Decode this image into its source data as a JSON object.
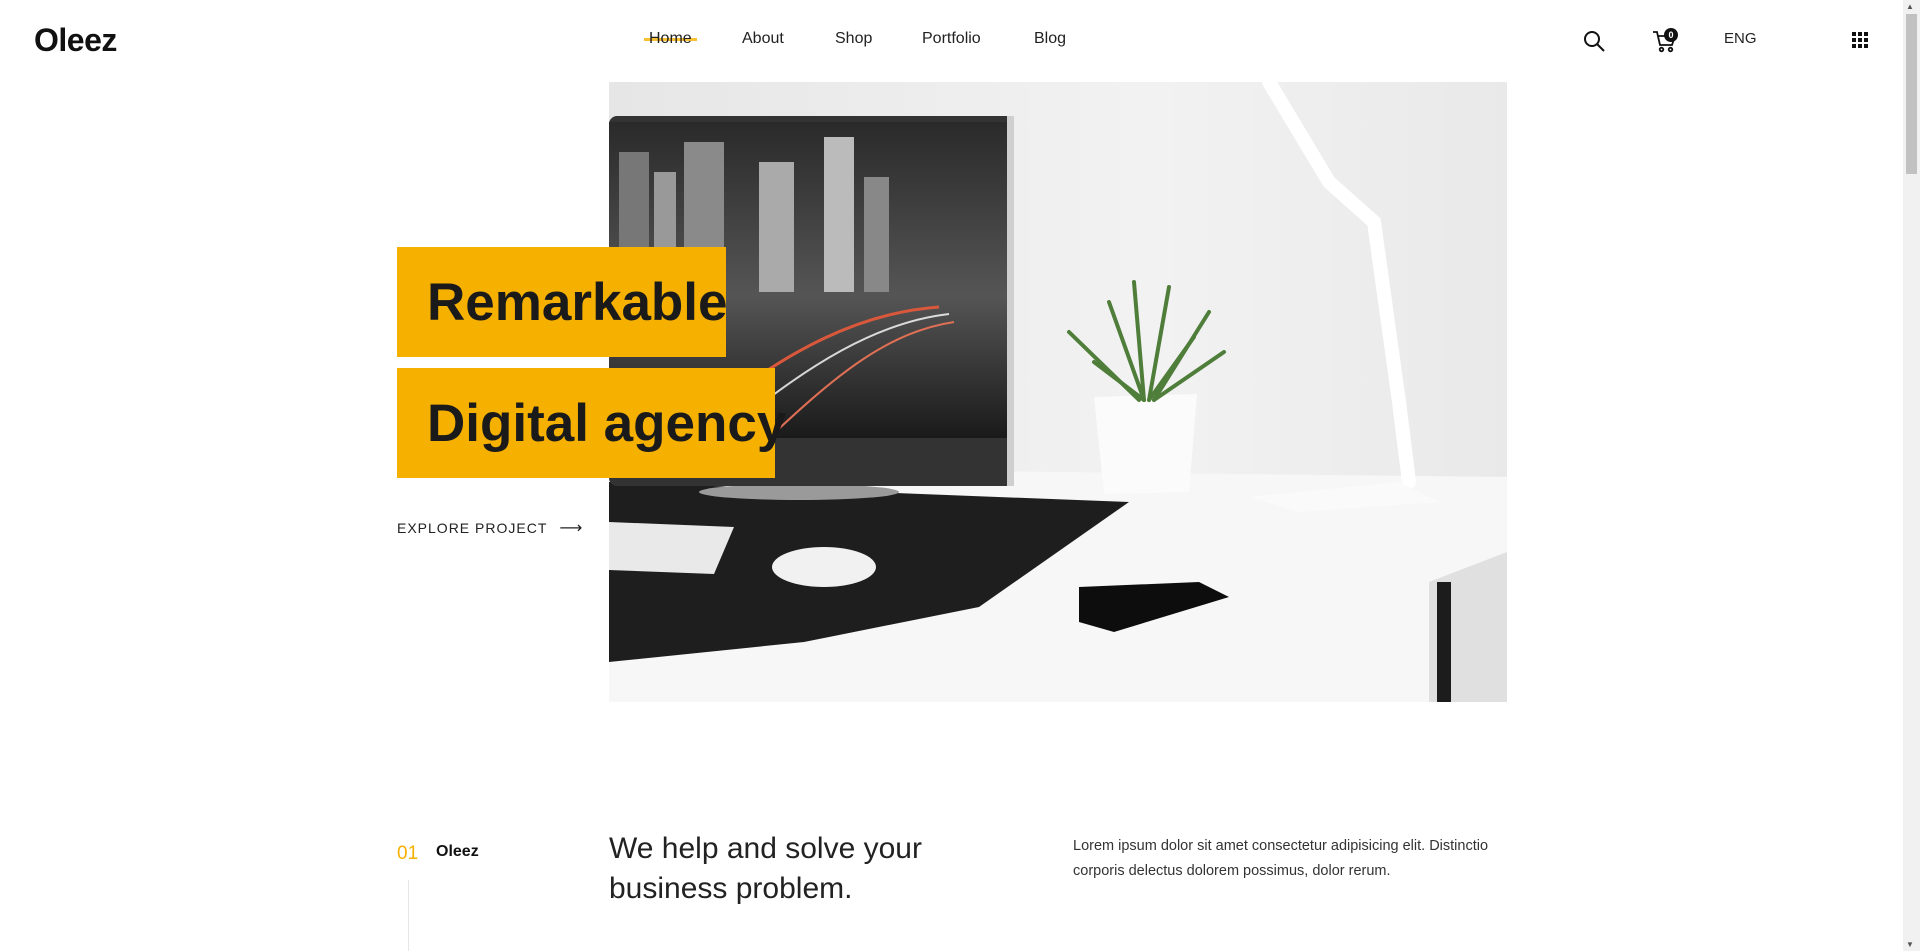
{
  "header": {
    "logo": "Oleez",
    "nav": [
      {
        "label": "Home",
        "active": true
      },
      {
        "label": "About",
        "active": false
      },
      {
        "label": "Shop",
        "active": false
      },
      {
        "label": "Portfolio",
        "active": false
      },
      {
        "label": "Blog",
        "active": false
      }
    ],
    "cart_count": "0",
    "language": "ENG",
    "icons": {
      "search": "search-icon",
      "cart": "cart-icon",
      "menu": "grid-menu-icon"
    }
  },
  "hero": {
    "line1": "Remarkable",
    "line2": "Digital agency",
    "cta": "EXPLORE PROJECT",
    "cta_arrow": "⟶",
    "image": "desk-with-monitor-plant-lamp-photo"
  },
  "section": {
    "number": "01",
    "brand": "Oleez",
    "title": "We help and solve your business problem.",
    "text": "Lorem ipsum dolor sit amet consectetur adipisicing elit. Distinctio corporis delectus dolorem possimus, dolor rerum."
  },
  "colors": {
    "accent": "#f6b100",
    "text": "#111111",
    "background": "#ffffff"
  }
}
